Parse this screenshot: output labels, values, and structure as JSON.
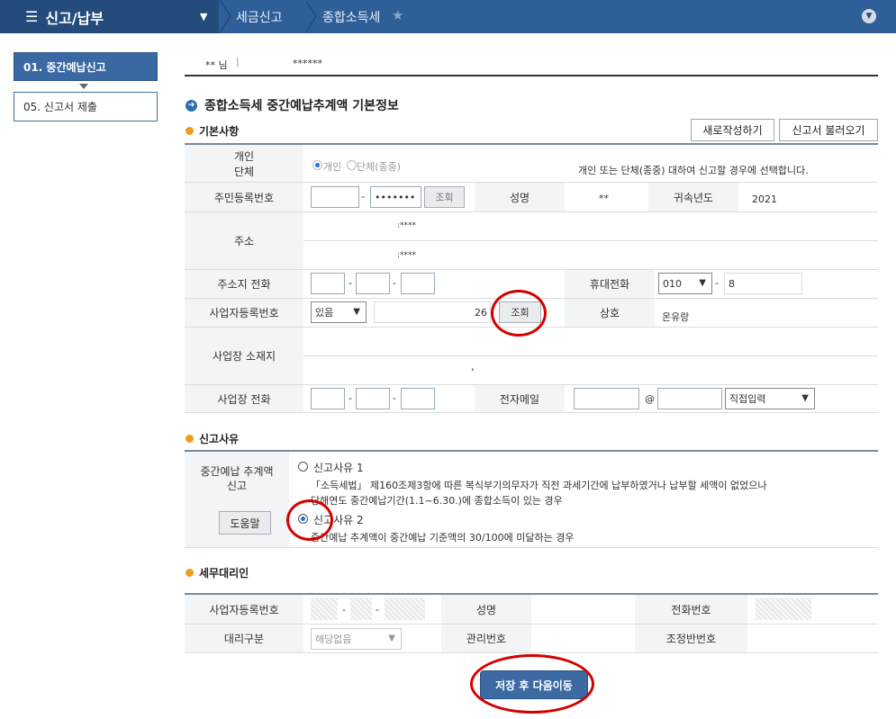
{
  "topbar": {
    "menu_icon": "hamburger-icon",
    "menu_label": "신고/납부",
    "breadcrumb": [
      "세금신고",
      "종합소득세"
    ],
    "star_icon": "star-icon",
    "collapse_icon": "chevron-down-icon"
  },
  "nav": {
    "items": [
      {
        "label": "01. 중간예납신고",
        "active": true
      },
      {
        "label": "05. 신고서 제출",
        "active": false
      }
    ]
  },
  "user": {
    "name": "** 님",
    "separator": "|",
    "ssn_mask": "******"
  },
  "page_title": "종합소득세 중간예납추계액 기본정보",
  "basic": {
    "heading": "기본사항",
    "new_button": "새로작성하기",
    "load_button": "신고서 불러오기",
    "type_label": "개인\n단체",
    "type_opt1": "개인",
    "type_opt2": "단체(종중)",
    "type_hint": "개인 또는 단체(종중) 대하여 신고할 경우에 선택합니다.",
    "rrn_label": "주민등록번호",
    "rrn_back": "•••••••",
    "lookup": "조회",
    "name_label": "성명",
    "name_value": "**",
    "year_label": "귀속년도",
    "year_value": "2021",
    "addr_label": "주소",
    "addr_line1": ":****",
    "addr_line2": ":****",
    "home_phone_label": "주소지 전화",
    "mobile_label": "휴대전화",
    "mobile_prefix": "010",
    "mobile_mid": "8",
    "biz_no_label": "사업자등록번호",
    "biz_select": "있음",
    "biz_no_tail": "26",
    "biz_lookup": "조회",
    "company_label": "상호",
    "company_value": "온유랑",
    "biz_addr_label": "사업장 소재지",
    "biz_addr_value": ",",
    "biz_phone_label": "사업장 전화",
    "email_label": "전자메일",
    "email_at": "@",
    "email_domain": "직접입력"
  },
  "reason": {
    "heading": "신고사유",
    "label": "중간예납 추계액 신고",
    "help": "도움말",
    "opt1_title": "신고사유 1",
    "opt1_desc1": "「소득세법」 제160조제3항에 따른 복식부기의무자가 직전 과세기간에 납부하였거나 납부할 세액이 없었으나",
    "opt1_desc2": "당해연도 중간예납기간(1.1~6.30.)에 종합소득이 있는 경우",
    "opt2_title": "신고사유 2",
    "opt2_desc": "중간예납 추계액이 중간예납 기준액의 30/100에 미달하는 경우"
  },
  "agent": {
    "heading": "세무대리인",
    "biz_no_label": "사업자등록번호",
    "name_label": "성명",
    "phone_label": "전화번호",
    "type_label": "대리구분",
    "type_value": "해당없음",
    "mgmt_label": "관리번호",
    "adj_label": "조정반번호"
  },
  "save_button": "저장 후 다음이동",
  "colors": {
    "topbar": "#2f5f99",
    "accent": "#3d6aa3",
    "annotation": "#d40000"
  }
}
